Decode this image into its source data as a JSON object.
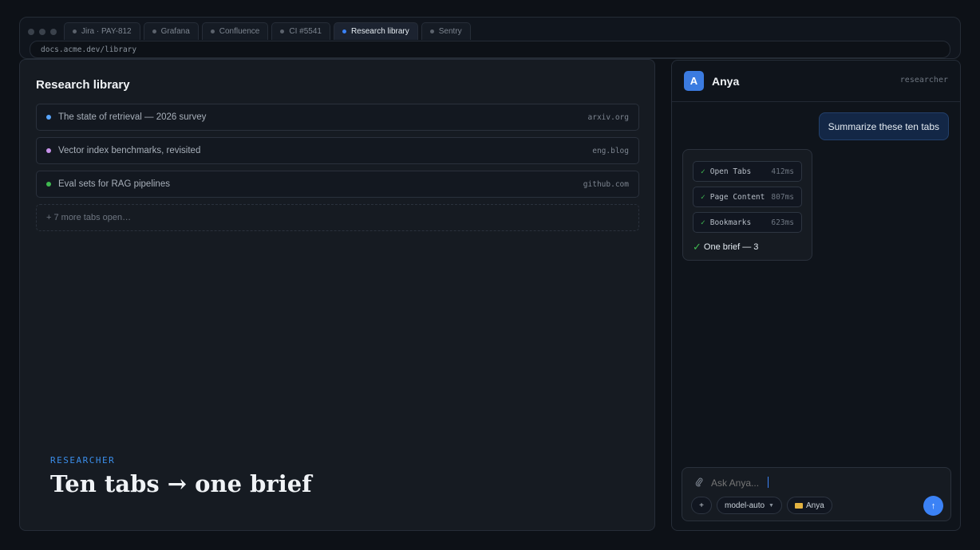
{
  "browser": {
    "tabs": [
      {
        "label": "Jira · PAY-812",
        "active": false
      },
      {
        "label": "Grafana",
        "active": false
      },
      {
        "label": "Confluence",
        "active": false
      },
      {
        "label": "CI #5541",
        "active": false
      },
      {
        "label": "Research library",
        "active": true
      },
      {
        "label": "Sentry",
        "active": false
      }
    ],
    "url": "docs.acme.dev/library"
  },
  "library": {
    "title": "Research library",
    "items": [
      {
        "title": "The state of retrieval — 2026 survey",
        "source": "arxiv.org",
        "color": "#58a6ff"
      },
      {
        "title": "Vector index benchmarks, revisited",
        "source": "eng.blog",
        "color": "#c792ea"
      },
      {
        "title": "Eval sets for RAG pipelines",
        "source": "github.com",
        "color": "#3fb950"
      }
    ],
    "more": "+ 7 more tabs open…"
  },
  "overlay": {
    "kicker": "RESEARCHER",
    "headline": "Ten tabs → one brief"
  },
  "agent": {
    "avatar_letter": "A",
    "name": "Anya",
    "role": "researcher",
    "user_message": "Summarize these ten tabs",
    "tools": [
      {
        "name": "Open Tabs",
        "ms": "412ms"
      },
      {
        "name": "Page Content",
        "ms": "807ms"
      },
      {
        "name": "Bookmarks",
        "ms": "623ms"
      }
    ],
    "result": "One brief — 3",
    "composer": {
      "placeholder": "Ask Anya...",
      "plus": "+",
      "model": "model-auto",
      "folder": "Anya",
      "send": "↑"
    }
  },
  "icons": {
    "attach": "paperclip-icon",
    "check": "check-icon",
    "folder": "folder-icon",
    "send": "arrow-up-icon"
  }
}
